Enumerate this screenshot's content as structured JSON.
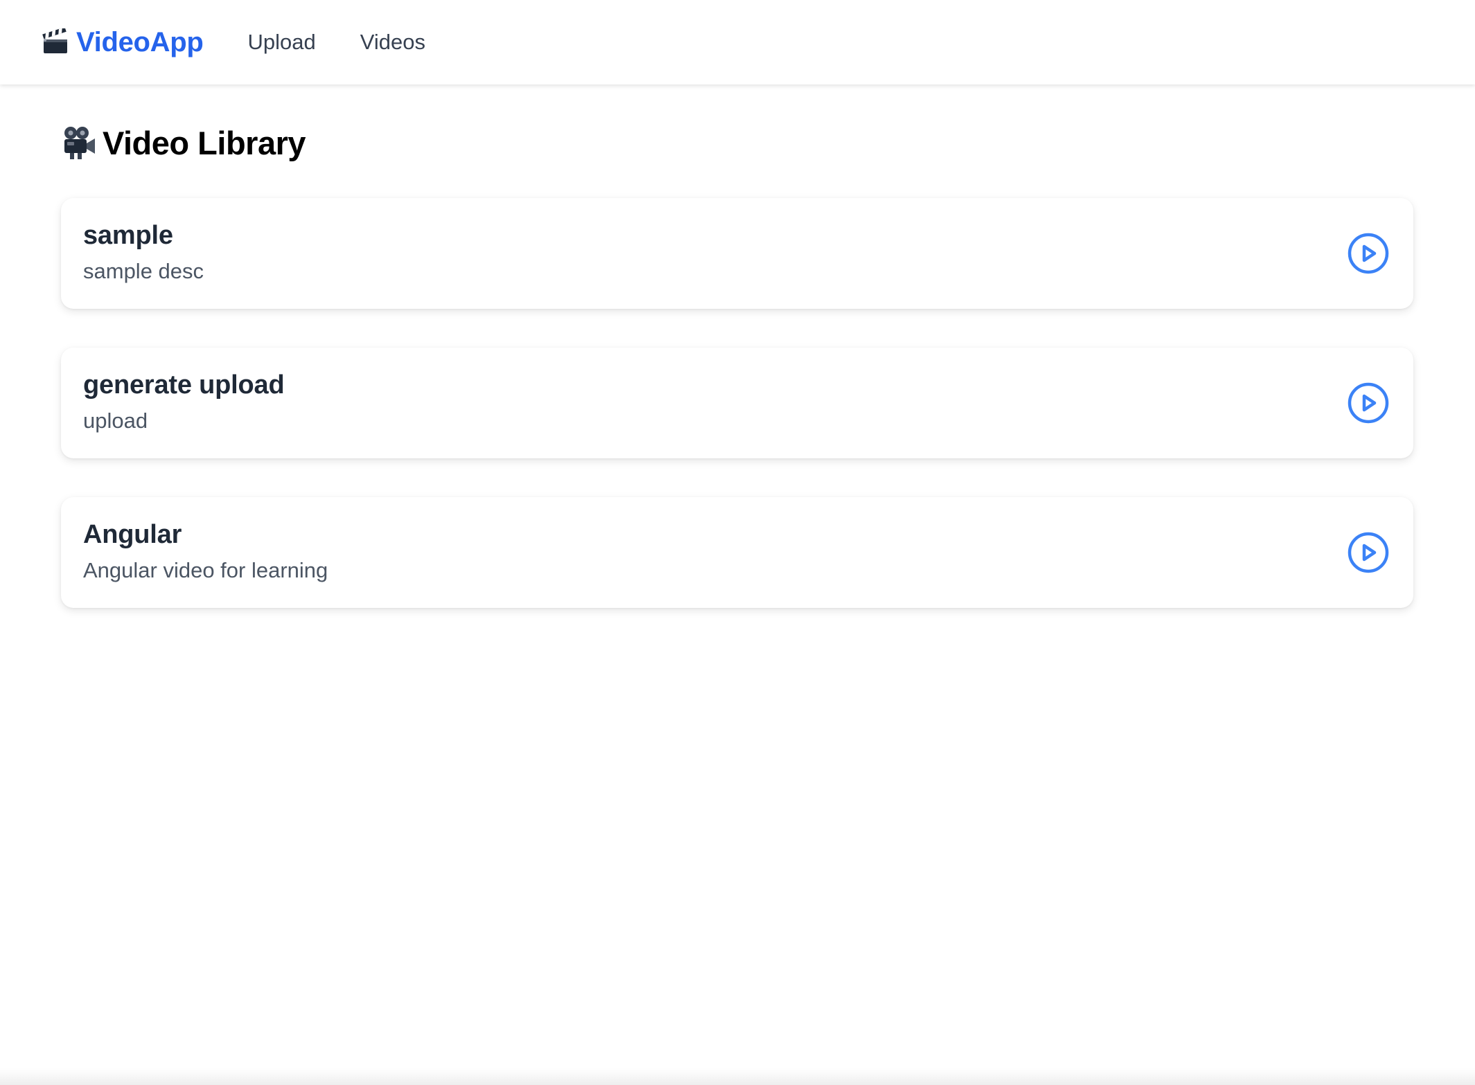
{
  "navbar": {
    "brand_icon": "clapper-board-icon",
    "brand_label": "VideoApp",
    "links": [
      {
        "label": "Upload"
      },
      {
        "label": "Videos"
      }
    ]
  },
  "page": {
    "title_icon": "movie-camera-icon",
    "title": "Video Library"
  },
  "videos": [
    {
      "title": "sample",
      "description": "sample desc",
      "action_icon": "play-circle-icon"
    },
    {
      "title": "generate upload",
      "description": "upload",
      "action_icon": "play-circle-icon"
    },
    {
      "title": "Angular",
      "description": "Angular video for learning",
      "action_icon": "play-circle-icon"
    }
  ],
  "colors": {
    "brand": "#2563eb",
    "play_icon": "#3b82f6",
    "nav_text": "#374151",
    "card_title": "#1f2937",
    "card_desc": "#4b5563"
  }
}
